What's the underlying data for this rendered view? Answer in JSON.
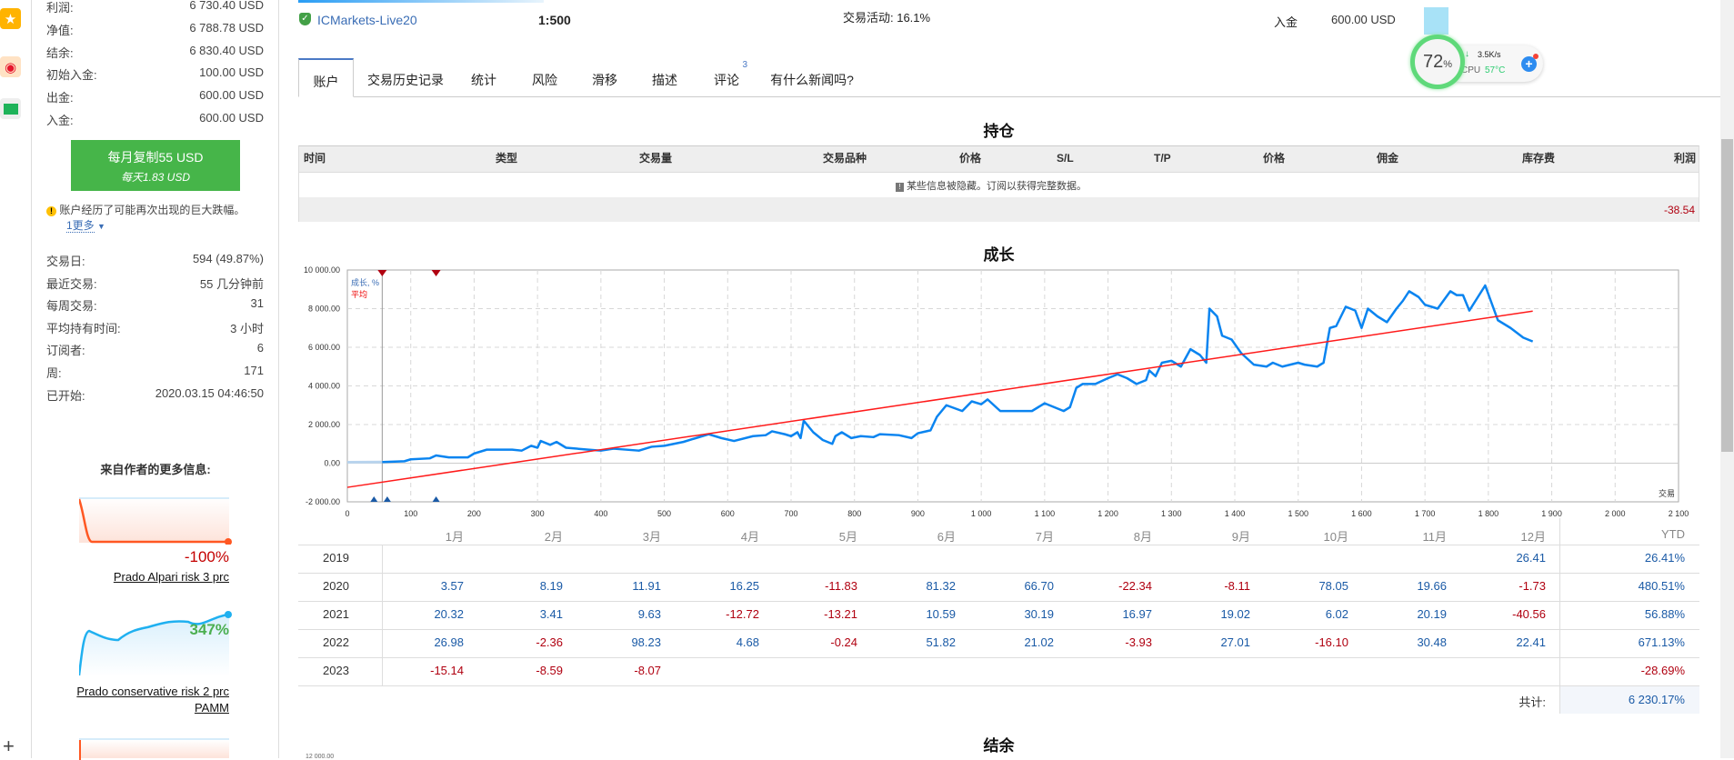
{
  "left_strip": {
    "icons": [
      "star-icon",
      "weibo-icon",
      "mail-icon",
      "plus-icon"
    ]
  },
  "sidebar": {
    "stats_top": [
      {
        "label": "利润:",
        "value": "6 730.40 USD"
      },
      {
        "label": "净值:",
        "value": "6 788.78 USD"
      },
      {
        "label": "结余:",
        "value": "6 830.40 USD"
      },
      {
        "label": "初始入金:",
        "value": "100.00 USD"
      },
      {
        "label": "出金:",
        "value": "600.00 USD"
      },
      {
        "label": "入金:",
        "value": "600.00 USD"
      }
    ],
    "copy_button": {
      "line1": "每月复制55 USD",
      "line2": "每天1.83 USD"
    },
    "warning": "账户经历了可能再次出现的巨大跌幅。",
    "more_link": "1更多",
    "stats_bottom": [
      {
        "label": "交易日:",
        "value": "594 (49.87%)"
      },
      {
        "label": "最近交易:",
        "value": "55 几分钟前"
      },
      {
        "label": "每周交易:",
        "value": "31"
      },
      {
        "label": "平均持有时间:",
        "value": "3 小时"
      },
      {
        "label": "订阅者:",
        "value": "6"
      },
      {
        "label": "周:",
        "value": "171"
      },
      {
        "label": "已开始:",
        "value": "2020.03.15 04:46:50"
      }
    ],
    "more_from_author": "来自作者的更多信息:",
    "signals": [
      {
        "growth": "-100%",
        "name": "Prado Alpari risk 3 prc",
        "color": "#ff5722"
      },
      {
        "growth": "347%",
        "name": "Prado conservative risk 2 prc PAMM",
        "color": "#1fb0f0"
      }
    ]
  },
  "header": {
    "server": "ICMarkets-Live20",
    "leverage": "1:500",
    "activity": "交易活动: 16.1%",
    "deposit_label": "入金",
    "deposit_value": "600.00 USD"
  },
  "widget": {
    "percent": "72",
    "percent_sign": "%",
    "speed": "3.5K/s",
    "cpu_label": "CPU",
    "cpu_temp": "57°C"
  },
  "tabs": [
    {
      "label": "账户"
    },
    {
      "label": "交易历史记录"
    },
    {
      "label": "统计"
    },
    {
      "label": "风险"
    },
    {
      "label": "滑移"
    },
    {
      "label": "描述"
    },
    {
      "label": "评论",
      "badge": "3"
    },
    {
      "label": "有什么新闻吗?"
    }
  ],
  "positions": {
    "title": "持仓",
    "columns": [
      "时间",
      "类型",
      "交易量",
      "交易品种",
      "价格",
      "S/L",
      "T/P",
      "价格",
      "佣金",
      "库存费",
      "利润"
    ],
    "hidden_note": "某些信息被隐藏。订阅以获得完整数据。",
    "total_profit": "-38.54"
  },
  "growth_title": "成长",
  "chart_data": {
    "type": "line",
    "title": "成长",
    "xlabel": "交易",
    "ylabel": "",
    "xlim": [
      0,
      2100
    ],
    "ylim": [
      -2000,
      10000
    ],
    "xticks": [
      "0",
      "100",
      "200",
      "300",
      "400",
      "500",
      "600",
      "700",
      "800",
      "900",
      "1 000",
      "1 100",
      "1 200",
      "1 300",
      "1 400",
      "1 500",
      "1 600",
      "1 700",
      "1 800",
      "1 900",
      "2 000",
      "2 100"
    ],
    "yticks": [
      "10 000.00",
      "8 000.00",
      "6 000.00",
      "4 000.00",
      "2 000.00",
      "0.00",
      "-2 000.00"
    ],
    "legend": [
      "成长, %",
      "平均"
    ],
    "grid": true,
    "series": [
      {
        "name": "成长, %",
        "color": "#0a84f0",
        "points": [
          [
            0,
            50
          ],
          [
            55,
            60
          ],
          [
            90,
            100
          ],
          [
            100,
            200
          ],
          [
            130,
            250
          ],
          [
            140,
            400
          ],
          [
            160,
            300
          ],
          [
            190,
            300
          ],
          [
            200,
            500
          ],
          [
            220,
            700
          ],
          [
            260,
            700
          ],
          [
            275,
            650
          ],
          [
            290,
            900
          ],
          [
            300,
            800
          ],
          [
            305,
            1150
          ],
          [
            320,
            950
          ],
          [
            330,
            1100
          ],
          [
            345,
            800
          ],
          [
            380,
            700
          ],
          [
            400,
            650
          ],
          [
            420,
            750
          ],
          [
            460,
            650
          ],
          [
            480,
            850
          ],
          [
            500,
            900
          ],
          [
            530,
            1100
          ],
          [
            550,
            1300
          ],
          [
            570,
            1500
          ],
          [
            590,
            1300
          ],
          [
            610,
            1150
          ],
          [
            640,
            1400
          ],
          [
            660,
            1450
          ],
          [
            670,
            1650
          ],
          [
            690,
            1500
          ],
          [
            700,
            1400
          ],
          [
            710,
            1600
          ],
          [
            715,
            1300
          ],
          [
            720,
            2200
          ],
          [
            735,
            1600
          ],
          [
            750,
            1200
          ],
          [
            765,
            1000
          ],
          [
            770,
            1400
          ],
          [
            780,
            1600
          ],
          [
            795,
            1300
          ],
          [
            810,
            1400
          ],
          [
            830,
            1350
          ],
          [
            840,
            1500
          ],
          [
            870,
            1450
          ],
          [
            890,
            1300
          ],
          [
            900,
            1550
          ],
          [
            920,
            1700
          ],
          [
            930,
            2400
          ],
          [
            945,
            3000
          ],
          [
            970,
            2700
          ],
          [
            985,
            3200
          ],
          [
            1000,
            3050
          ],
          [
            1010,
            3300
          ],
          [
            1030,
            2700
          ],
          [
            1060,
            2700
          ],
          [
            1080,
            2700
          ],
          [
            1090,
            2900
          ],
          [
            1100,
            3100
          ],
          [
            1130,
            2700
          ],
          [
            1140,
            2900
          ],
          [
            1150,
            3900
          ],
          [
            1160,
            4100
          ],
          [
            1180,
            4100
          ],
          [
            1200,
            4400
          ],
          [
            1215,
            4600
          ],
          [
            1230,
            4400
          ],
          [
            1245,
            4100
          ],
          [
            1260,
            4300
          ],
          [
            1265,
            4800
          ],
          [
            1275,
            4500
          ],
          [
            1285,
            5200
          ],
          [
            1300,
            5300
          ],
          [
            1315,
            5000
          ],
          [
            1330,
            5900
          ],
          [
            1345,
            5600
          ],
          [
            1355,
            5200
          ],
          [
            1360,
            8000
          ],
          [
            1372,
            7600
          ],
          [
            1380,
            6600
          ],
          [
            1395,
            6400
          ],
          [
            1410,
            5700
          ],
          [
            1430,
            5100
          ],
          [
            1450,
            5000
          ],
          [
            1460,
            5200
          ],
          [
            1475,
            5000
          ],
          [
            1500,
            5200
          ],
          [
            1510,
            5100
          ],
          [
            1530,
            5000
          ],
          [
            1540,
            5200
          ],
          [
            1550,
            7000
          ],
          [
            1560,
            7100
          ],
          [
            1575,
            8100
          ],
          [
            1590,
            7900
          ],
          [
            1600,
            7000
          ],
          [
            1610,
            8000
          ],
          [
            1625,
            7600
          ],
          [
            1640,
            7300
          ],
          [
            1655,
            8000
          ],
          [
            1665,
            8400
          ],
          [
            1675,
            8900
          ],
          [
            1690,
            8600
          ],
          [
            1700,
            8200
          ],
          [
            1720,
            8000
          ],
          [
            1740,
            8900
          ],
          [
            1750,
            8700
          ],
          [
            1760,
            8700
          ],
          [
            1770,
            7900
          ],
          [
            1795,
            9200
          ],
          [
            1815,
            7400
          ],
          [
            1835,
            7000
          ],
          [
            1855,
            6500
          ],
          [
            1870,
            6300
          ]
        ]
      },
      {
        "name": "平均",
        "color": "#ff1a1a",
        "points": [
          [
            0,
            -1250
          ],
          [
            1870,
            7870
          ]
        ]
      }
    ],
    "markers_top": [
      55,
      140
    ],
    "markers_bottom": [
      42,
      63,
      140
    ],
    "start_line": 55
  },
  "monthly": {
    "months": [
      "1月",
      "2月",
      "3月",
      "4月",
      "5月",
      "6月",
      "7月",
      "8月",
      "9月",
      "10月",
      "11月",
      "12月"
    ],
    "ytd_label": "YTD",
    "rows": [
      {
        "year": "2019",
        "values": [
          "",
          "",
          "",
          "",
          "",
          "",
          "",
          "",
          "",
          "",
          "",
          "26.41"
        ],
        "ytd": "26.41%"
      },
      {
        "year": "2020",
        "values": [
          "3.57",
          "8.19",
          "11.91",
          "16.25",
          "-11.83",
          "81.32",
          "66.70",
          "-22.34",
          "-8.11",
          "78.05",
          "19.66",
          "-1.73"
        ],
        "ytd": "480.51%"
      },
      {
        "year": "2021",
        "values": [
          "20.32",
          "3.41",
          "9.63",
          "-12.72",
          "-13.21",
          "10.59",
          "30.19",
          "16.97",
          "19.02",
          "6.02",
          "20.19",
          "-40.56"
        ],
        "ytd": "56.88%"
      },
      {
        "year": "2022",
        "values": [
          "26.98",
          "-2.36",
          "98.23",
          "4.68",
          "-0.24",
          "51.82",
          "21.02",
          "-3.93",
          "27.01",
          "-16.10",
          "30.48",
          "22.41"
        ],
        "ytd": "671.13%"
      },
      {
        "year": "2023",
        "values": [
          "-15.14",
          "-8.59",
          "-8.07",
          "",
          "",
          "",
          "",
          "",
          "",
          "",
          "",
          ""
        ],
        "ytd": "-28.69%"
      }
    ],
    "total_label": "共计:",
    "total_value": "6 230.17%"
  },
  "balance_title": "结余"
}
